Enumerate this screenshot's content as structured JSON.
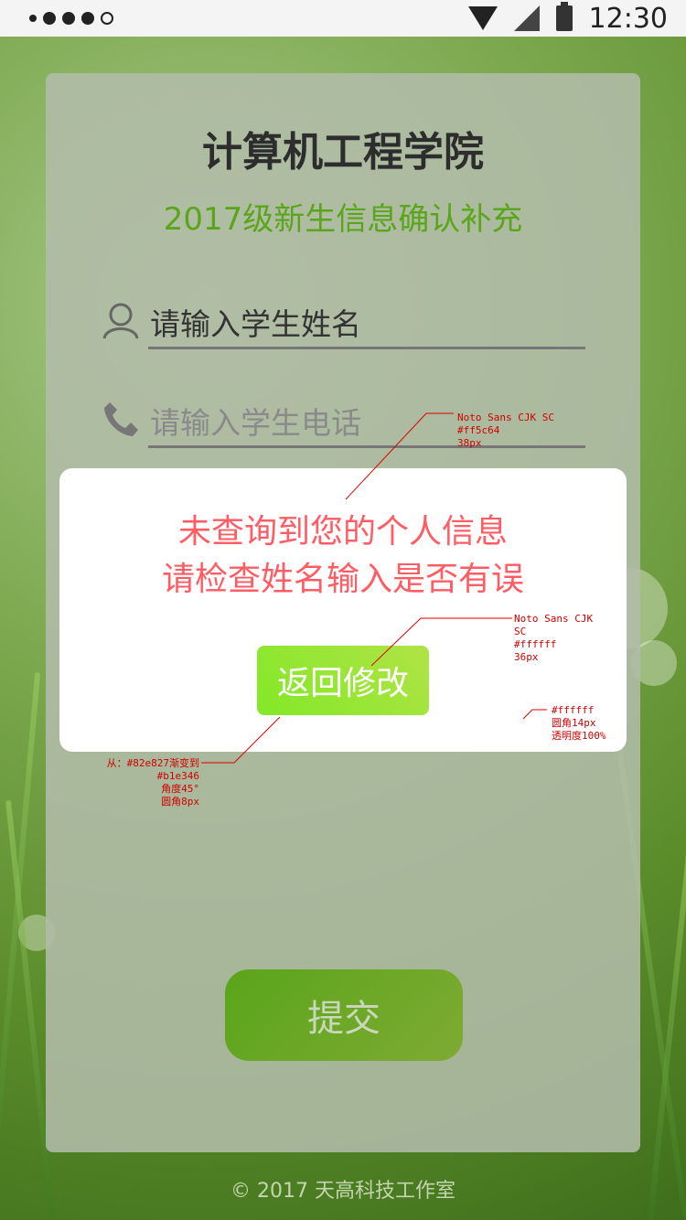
{
  "status_bar": {
    "time": "12:30"
  },
  "form": {
    "title": "计算机工程学院",
    "subtitle": "2017级新生信息确认补充",
    "name_field": "请输入学生姓名",
    "phone_placeholder": "请输入学生电话",
    "submit_label": "提交"
  },
  "dialog": {
    "message_line1": "未查询到您的个人信息",
    "message_line2": "请检查姓名输入是否有误",
    "back_label": "返回修改"
  },
  "footer": {
    "copyright": "© 2017 天高科技工作室"
  },
  "annotations": {
    "message_spec": [
      "Noto Sans CJK SC",
      "#ff5c64",
      "38px"
    ],
    "button_text_spec": [
      "Noto Sans CJK",
      "SC",
      "#ffffff",
      "36px"
    ],
    "dialog_spec": [
      "#ffffff",
      "圆角14px",
      "透明度100%"
    ],
    "button_spec": [
      "从：#82e827渐变到#b1e346",
      "角度45°",
      "圆角8px"
    ]
  },
  "colors": {
    "accent_green": "#5aa51a",
    "dialog_text": "#ff5c64",
    "button_gradient_start": "#82e827",
    "button_gradient_end": "#b1e346"
  },
  "icons": [
    "wifi-icon",
    "cellular-signal-icon",
    "battery-icon",
    "user-icon",
    "phone-icon"
  ]
}
